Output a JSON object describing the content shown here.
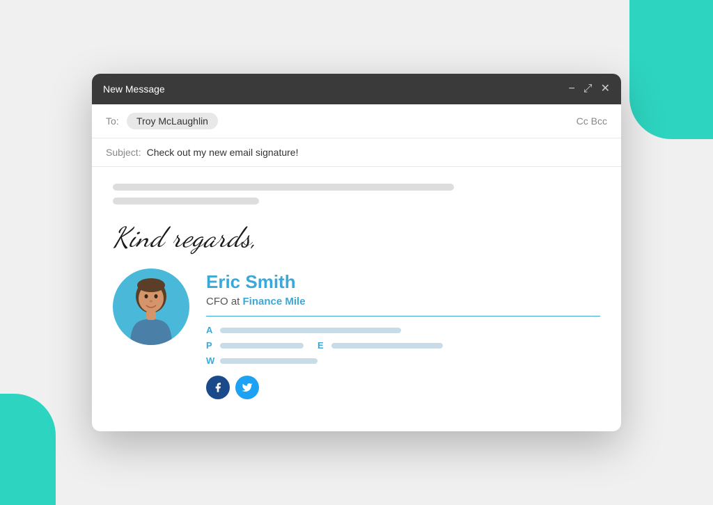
{
  "background": {
    "teal_color": "#2dd4bf"
  },
  "window": {
    "title": "New Message",
    "controls": {
      "minimize": "−",
      "maximize": "⤢",
      "close": "✕"
    }
  },
  "header": {
    "to_label": "To:",
    "recipient": "Troy McLaughlin",
    "cc_bcc": "Cc  Bcc"
  },
  "subject": {
    "label": "Subject:",
    "text": "Check out my new email signature!"
  },
  "body": {
    "lines": [
      {
        "width": "70%"
      },
      {
        "width": "30%"
      }
    ]
  },
  "signature": {
    "greeting": "Kind regards,",
    "name": "Eric Smith",
    "title_prefix": "CFO at ",
    "company": "Finance Mile",
    "divider": true,
    "details": {
      "address_label": "A",
      "phone_label": "P",
      "email_label": "E",
      "website_label": "W"
    },
    "social": {
      "facebook_title": "Facebook",
      "twitter_title": "Twitter"
    }
  }
}
